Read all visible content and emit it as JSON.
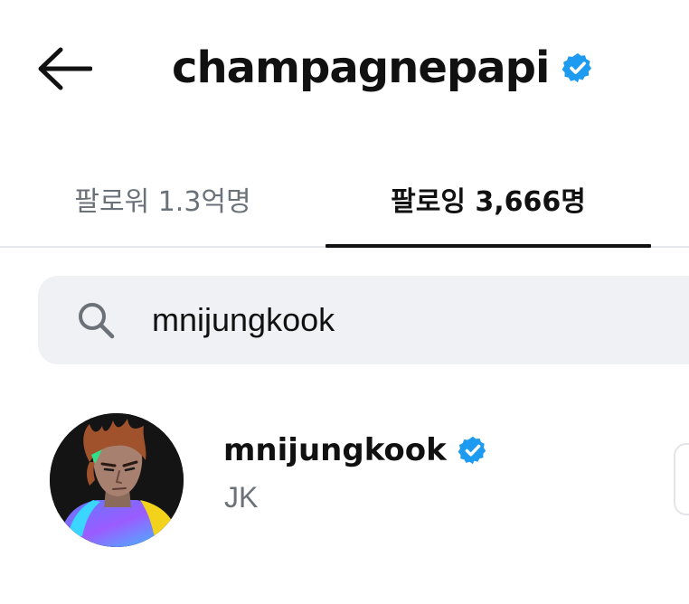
{
  "header": {
    "back_icon": "arrow-left-icon",
    "title": "champagnepapi",
    "verified_icon": "verified-badge-icon"
  },
  "tabs": [
    {
      "label": "팔로워 1.3억명",
      "active": false
    },
    {
      "label": "팔로잉 3,666명",
      "active": true
    }
  ],
  "search": {
    "icon": "search-icon",
    "value": "mnijungkook"
  },
  "results": [
    {
      "username": "mnijungkook",
      "display_name": "JK",
      "verified": true,
      "avatar_icon": "avatar-illustration"
    }
  ],
  "colors": {
    "verified": "#1d9bf0",
    "text_primary": "#111111",
    "text_secondary": "#6b7178",
    "search_bg": "#eff1f4",
    "divider": "#e6e8eb"
  }
}
